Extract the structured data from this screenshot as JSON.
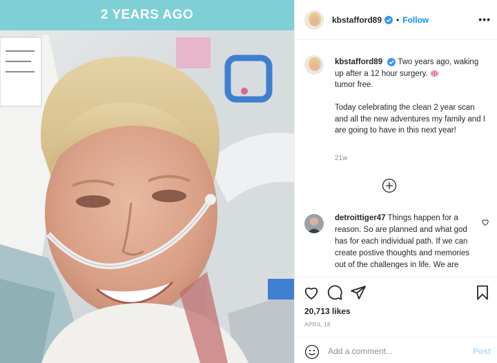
{
  "banner": {
    "text": "2 YEARS AGO"
  },
  "header": {
    "username": "kbstafford89",
    "separator": "•",
    "follow_label": "Follow",
    "more_label": "•••"
  },
  "caption": {
    "username": "kbstafford89",
    "line1": "Two years ago, waking up after a 12 hour surgery.",
    "line2": "tumor free.",
    "paragraph2": "Today celebrating the clean 2 year scan and all the new adventures my family and I are going to have in this next year!",
    "time_ago": "21w"
  },
  "comment": {
    "username": "detroittiger47",
    "text": "Things happen for a reason. So are planned and what god has for each individual path. If we can create postive thoughts and memories out of the challenges in life. We are"
  },
  "actions": {
    "likes": "20,713 likes",
    "date": "APRIL 18"
  },
  "add_comment": {
    "placeholder": "Add a comment...",
    "post_label": "Post"
  },
  "icons": {
    "verified": "verified-badge-icon",
    "like": "heart-icon",
    "comment": "comment-bubble-icon",
    "share": "paper-plane-icon",
    "save": "bookmark-icon",
    "load_more": "plus-circle-icon",
    "emoji": "smiley-icon",
    "brain": "brain-emoji-icon"
  },
  "colors": {
    "banner": "#7ecfd6",
    "link": "#0095f6",
    "muted": "#8e8e8e",
    "post_disabled": "#b3dbff"
  }
}
